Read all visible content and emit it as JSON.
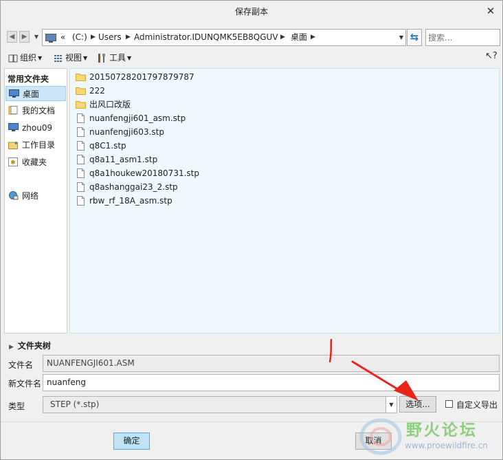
{
  "window": {
    "title": "保存副本"
  },
  "address_bar": {
    "crumbs": [
      "«",
      "(C:)",
      "Users",
      "Administrator.IDUNQMK5EB8QGUV",
      "桌面"
    ]
  },
  "search": {
    "placeholder": "搜索..."
  },
  "toolbar": {
    "organize": "组织",
    "view": "视图",
    "tools": "工具"
  },
  "sidebar": {
    "heading": "常用文件夹",
    "items": [
      {
        "label": "桌面",
        "icon": "desktop-icon",
        "selected": true
      },
      {
        "label": "我的文档",
        "icon": "documents-icon"
      },
      {
        "label": "zhou09",
        "icon": "computer-icon"
      },
      {
        "label": "工作目录",
        "icon": "working-directory-icon"
      },
      {
        "label": "收藏夹",
        "icon": "favorites-icon"
      },
      {
        "label": "网络",
        "icon": "network-icon"
      }
    ]
  },
  "files": [
    {
      "name": "20150728201797879787",
      "type": "folder"
    },
    {
      "name": "222",
      "type": "folder"
    },
    {
      "name": "出风口改版",
      "type": "folder"
    },
    {
      "name": "nuanfengji601_asm.stp",
      "type": "file"
    },
    {
      "name": "nuanfengji603.stp",
      "type": "file"
    },
    {
      "name": "q8C1.stp",
      "type": "file"
    },
    {
      "name": "q8a11_asm1.stp",
      "type": "file"
    },
    {
      "name": "q8a1houkew20180731.stp",
      "type": "file"
    },
    {
      "name": "q8ashanggai23_2.stp",
      "type": "file"
    },
    {
      "name": "rbw_rf_18A_asm.stp",
      "type": "file"
    }
  ],
  "folder_tree": {
    "label": "文件夹树"
  },
  "form": {
    "filename_label": "文件名",
    "filename_value": "NUANFENGJI601.ASM",
    "new_filename_label": "新文件名",
    "new_filename_value": "nuanfeng",
    "type_label": "类型",
    "type_value": "STEP (*.stp)",
    "options_button": "选项...",
    "custom_export_label": "自定义导出",
    "custom_export_checked": false
  },
  "buttons": {
    "ok": "确定",
    "cancel": "取消"
  },
  "watermark": {
    "text_cn": "野火论坛",
    "url": "www.proewildfire.cn"
  },
  "colors": {
    "selection": "#cde6f7",
    "file_area_bg": "#eff8fd",
    "annotation": "#e8231b",
    "ok_button": "#bfe3f8"
  }
}
